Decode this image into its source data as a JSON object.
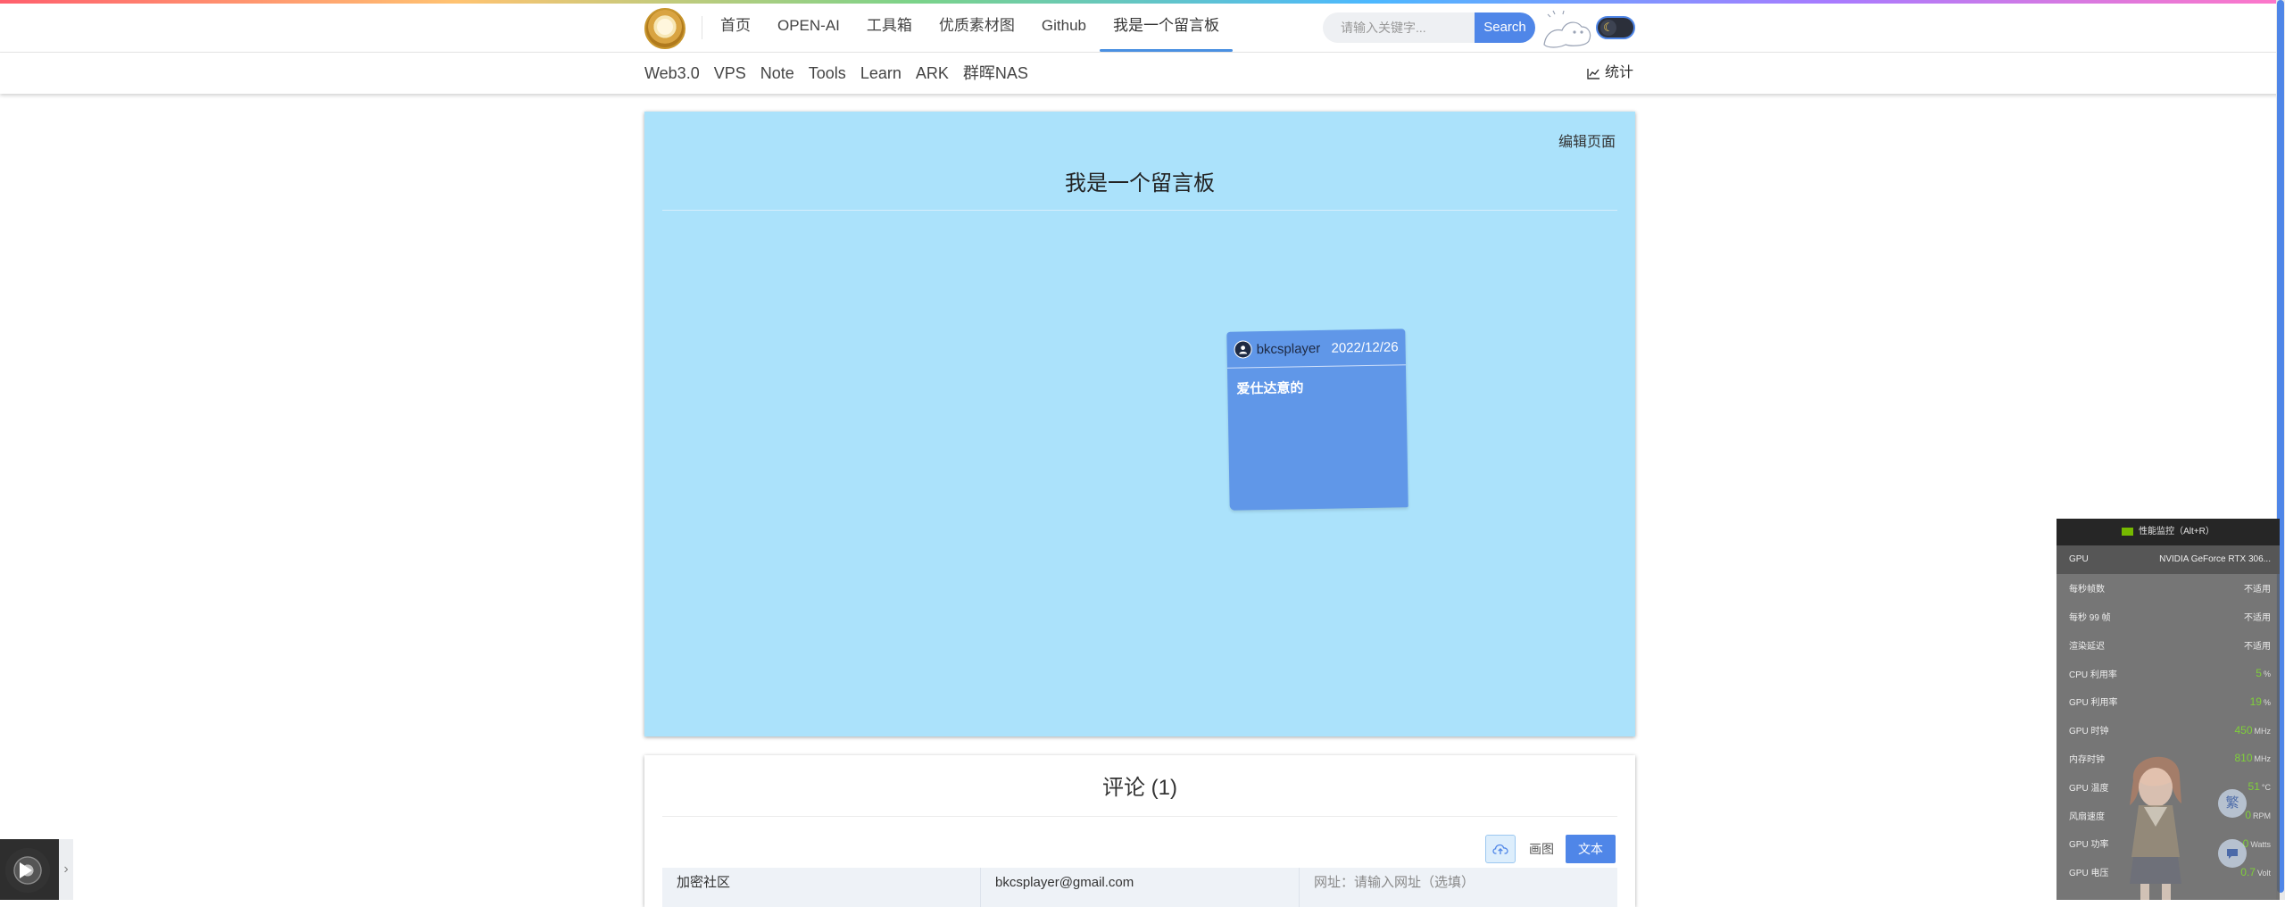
{
  "header": {
    "nav": [
      {
        "label": "首页"
      },
      {
        "label": "OPEN-AI"
      },
      {
        "label": "工具箱"
      },
      {
        "label": "优质素材图"
      },
      {
        "label": "Github"
      },
      {
        "label": "我是一个留言板",
        "active": true
      }
    ],
    "search": {
      "placeholder": "请输入关键字...",
      "button": "Search"
    },
    "theme_toggle_icon": "moon-icon"
  },
  "subnav": {
    "items": [
      "Web3.0",
      "VPS",
      "Note",
      "Tools",
      "Learn",
      "ARK",
      "群晖NAS"
    ],
    "stats_label": "统计"
  },
  "board": {
    "edit_label": "编辑页面",
    "title": "我是一个留言板",
    "background": "#abe2fb",
    "note": {
      "user": "bkcsplayer",
      "date": "2022/12/26",
      "text": "爱仕达意的",
      "color": "#6097e8"
    }
  },
  "comments": {
    "title": "评论 (1)",
    "tools": {
      "draw": "画图",
      "text": "文本"
    },
    "fields": {
      "community": "加密社区",
      "email": "bkcsplayer@gmail.com",
      "url": "网址：请输入网址（选填）"
    }
  },
  "perf_overlay": {
    "title": "性能监控（Alt+R）",
    "gpu_label": "GPU",
    "gpu_value": "NVIDIA GeForce RTX 306...",
    "rows": [
      {
        "label": "每秒帧数",
        "value": "不适用",
        "unit": ""
      },
      {
        "label": "每秒 99 帧",
        "value": "不适用",
        "unit": ""
      },
      {
        "label": "渲染延迟",
        "value": "不适用",
        "unit": ""
      },
      {
        "label": "CPU 利用率",
        "value": "5",
        "unit": "%"
      },
      {
        "label": "GPU 利用率",
        "value": "19",
        "unit": "%"
      },
      {
        "label": "GPU 时钟",
        "value": "450",
        "unit": "MHz"
      },
      {
        "label": "内存时钟",
        "value": "810",
        "unit": "MHz"
      },
      {
        "label": "GPU 温度",
        "value": "51",
        "unit": "°C"
      },
      {
        "label": "风扇速度",
        "value": "0",
        "unit": "RPM"
      },
      {
        "label": "GPU 功率",
        "value": "0",
        "unit": "Watts"
      },
      {
        "label": "GPU 电压",
        "value": "0.7",
        "unit": "Volt"
      }
    ],
    "side_button": "繁"
  },
  "colors": {
    "accent": "#4f86e8",
    "board": "#abe2fb",
    "note": "#6097e8",
    "gpu_green": "#76b900"
  }
}
